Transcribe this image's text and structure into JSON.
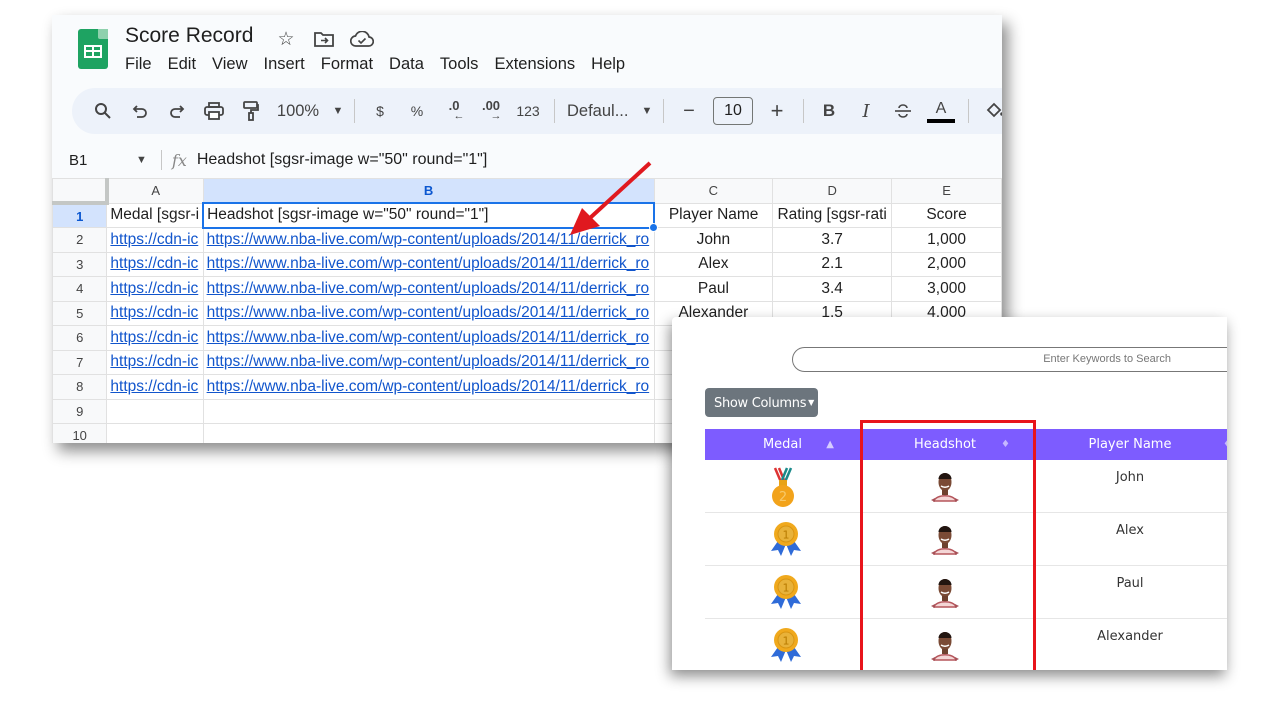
{
  "sheets": {
    "doc_title": "Score Record",
    "title_icons": [
      "star-icon",
      "move-to-folder-icon",
      "cloud-saved-icon"
    ],
    "menu": [
      "File",
      "Edit",
      "View",
      "Insert",
      "Format",
      "Data",
      "Tools",
      "Extensions",
      "Help"
    ],
    "toolbar": {
      "zoom": "100%",
      "currency": "$",
      "percent": "%",
      "decrease_decimal": ".0",
      "increase_decimal": ".00",
      "number_format": "123",
      "font": "Defaul...",
      "font_size": "10",
      "minus": "−",
      "plus": "+",
      "bold": "B",
      "italic": "I",
      "textcolor": "A"
    },
    "formula_bar": {
      "name_box": "B1",
      "fx": "fx",
      "formula": "Headshot [sgsr-image w=\"50\" round=\"1\"]"
    },
    "columns": [
      "A",
      "B",
      "C",
      "D",
      "E"
    ],
    "row_numbers": [
      "1",
      "2",
      "3",
      "4",
      "5",
      "6",
      "7",
      "8",
      "9",
      "10"
    ],
    "header_row": [
      "Medal [sgsr-i",
      "Headshot [sgsr-image w=\"50\" round=\"1\"]",
      "Player Name",
      "Rating [sgsr-rati",
      "Score"
    ],
    "rows": [
      {
        "a": "https://cdn-ic",
        "b": "https://www.nba-live.com/wp-content/uploads/2014/11/derrick_ro",
        "c": "John",
        "d": "3.7",
        "e": "1,000"
      },
      {
        "a": "https://cdn-ic",
        "b": "https://www.nba-live.com/wp-content/uploads/2014/11/derrick_ro",
        "c": "Alex",
        "d": "2.1",
        "e": "2,000"
      },
      {
        "a": "https://cdn-ic",
        "b": "https://www.nba-live.com/wp-content/uploads/2014/11/derrick_ro",
        "c": "Paul",
        "d": "3.4",
        "e": "3,000"
      },
      {
        "a": "https://cdn-ic",
        "b": "https://www.nba-live.com/wp-content/uploads/2014/11/derrick_ro",
        "c": "Alexander",
        "d": "1.5",
        "e": "4,000"
      },
      {
        "a": "https://cdn-ic",
        "b": "https://www.nba-live.com/wp-content/uploads/2014/11/derrick_ro",
        "c": "",
        "d": "",
        "e": ""
      },
      {
        "a": "https://cdn-ic",
        "b": "https://www.nba-live.com/wp-content/uploads/2014/11/derrick_ro",
        "c": "",
        "d": "",
        "e": ""
      },
      {
        "a": "https://cdn-ic",
        "b": "https://www.nba-live.com/wp-content/uploads/2014/11/derrick_ro",
        "c": "",
        "d": "",
        "e": ""
      }
    ]
  },
  "web_table": {
    "search_placeholder": "Enter Keywords to Search",
    "show_columns_label": "Show Columns",
    "headers": [
      "Medal",
      "Headshot",
      "Player Name"
    ],
    "header_color": "#7d5cff",
    "highlight_color": "#e8141b",
    "rows": [
      {
        "medal": "medal-2nd-icon",
        "medal_number": "2",
        "headshot": "player-headshot",
        "name": "John"
      },
      {
        "medal": "medal-1st-ribbon-icon",
        "medal_number": "1",
        "headshot": "player-headshot",
        "name": "Alex"
      },
      {
        "medal": "medal-1st-ribbon-icon",
        "medal_number": "1",
        "headshot": "player-headshot",
        "name": "Paul"
      },
      {
        "medal": "medal-1st-ribbon-icon",
        "medal_number": "1",
        "headshot": "player-headshot",
        "name": "Alexander"
      }
    ]
  }
}
